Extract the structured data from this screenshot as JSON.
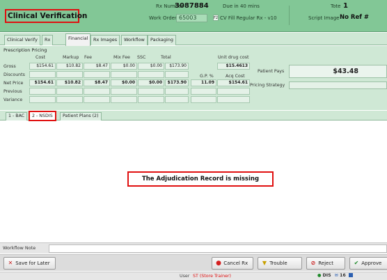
{
  "header": {
    "title": "Clinical Verification",
    "rx_number_label": "Rx Number",
    "rx_number": "3087884",
    "due": "Due in 40 mins",
    "work_order_label": "Work Order",
    "work_order": "65003",
    "fill_badge": "F2",
    "fill_type": "CV Fill Regular Rx - v10",
    "tote_label": "Tote",
    "tote": "1",
    "script_image_label": "Script Image",
    "script_image_value": "No Ref #"
  },
  "tabs": [
    {
      "label": "Clinical Verify"
    },
    {
      "label": "Rx"
    },
    {
      "label": "Financial"
    },
    {
      "label": "Rx Images"
    },
    {
      "label": "Workflow"
    },
    {
      "label": "Packaging"
    }
  ],
  "pricing": {
    "title": "Prescription Pricing",
    "columns": [
      "Cost",
      "Markup",
      "Fee",
      "Mix Fee",
      "SSC",
      "Total"
    ],
    "rows": [
      {
        "label": "Gross",
        "values": [
          "$154.61",
          "$10.82",
          "$8.47",
          "$0.00",
          "$0.00",
          "$173.90"
        ]
      },
      {
        "label": "Discounts",
        "values": [
          "",
          "",
          "",
          "",
          "",
          ""
        ]
      },
      {
        "label": "Net Price",
        "values": [
          "$154.61",
          "$10.82",
          "$8.47",
          "$0.00",
          "$0.00",
          "$173.90"
        ]
      },
      {
        "label": "Previous",
        "values": [
          "",
          "",
          "",
          "",
          "",
          ""
        ]
      },
      {
        "label": "Variance",
        "values": [
          "",
          "",
          "",
          "",
          "",
          ""
        ]
      }
    ],
    "unit_drug_cost_label": "Unit drug cost",
    "unit_drug_cost": "$15.4613",
    "gp_label": "G.P. %",
    "gp_value": "11.09",
    "acq_cost_label": "Acq Cost",
    "acq_cost": "$154.61",
    "patient_pays_label": "Patient Pays",
    "patient_pays": "$43.48",
    "pricing_strategy_label": "Pricing Strategy",
    "pricing_strategy": ""
  },
  "sub_tabs": [
    {
      "label": "1 - BAC"
    },
    {
      "label": "2 - NSDIS"
    },
    {
      "label": "Patient Plans (2)"
    }
  ],
  "content": {
    "message": "The Adjudication Record is missing"
  },
  "workflow_note": {
    "label": "Workflow Note",
    "value": ""
  },
  "actions": {
    "save_for_later": "Save for Later",
    "cancel_rx": "Cancel Rx",
    "trouble": "Trouble",
    "reject": "Reject",
    "approve": "Approve"
  },
  "status": {
    "user_label": "User",
    "user_value": "ST (Store Trainer)",
    "dis_label": "DIS",
    "mail_count": "16"
  },
  "colors": {
    "header_green": "#82c796",
    "panel_green": "#cfe8d5",
    "highlight_red": "#e01010"
  }
}
